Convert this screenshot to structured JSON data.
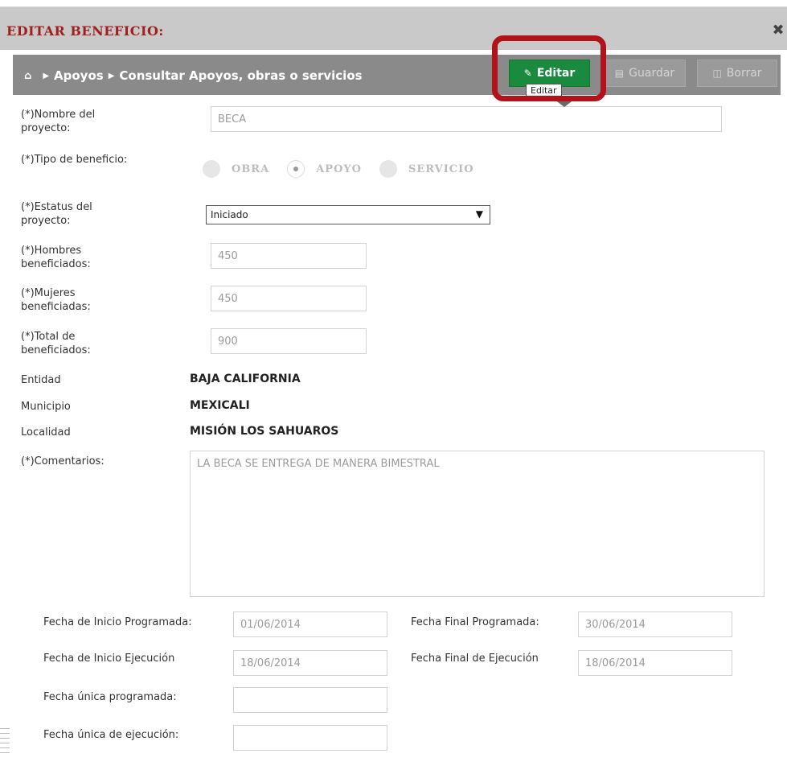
{
  "dialog": {
    "title": "Editar beneficio:",
    "close_symbol": "✖"
  },
  "breadcrumb": {
    "home_icon": "home-icon",
    "items": [
      "Apoyos",
      "Consultar Apoyos, obras o servicios"
    ]
  },
  "toolbar": {
    "edit_label": "Editar",
    "save_label": "Guardar",
    "delete_label": "Borrar",
    "tooltip": "Editar",
    "edit_color": "#1a8a3e",
    "highlight_color": "#b3121b"
  },
  "form": {
    "project_name_label_1": "(*)Nombre del",
    "project_name_label_2": "proyecto:",
    "project_name_value": "BECA",
    "benefit_type_label": "(*)Tipo de beneficio:",
    "benefit_options": [
      "OBRA",
      "APOYO",
      "SERVICIO"
    ],
    "benefit_selected": "APOYO",
    "status_label_1": "(*)Estatus del",
    "status_label_2": "proyecto:",
    "status_value": "Iniciado",
    "men_label_1": "(*)Hombres",
    "men_label_2": "beneficiados:",
    "men_value": "450",
    "women_label_1": "(*)Mujeres",
    "women_label_2": "beneficiadas:",
    "women_value": "450",
    "total_label_1": "(*)Total de",
    "total_label_2": "beneficiados:",
    "total_value": "900",
    "entity_label": "Entidad",
    "entity_value": "BAJA CALIFORNIA",
    "municipality_label": "Municipio",
    "municipality_value": "MEXICALI",
    "locality_label": "Localidad",
    "locality_value": "MISIÓN LOS SAHUAROS",
    "comments_label": "(*)Comentarios:",
    "comments_value": "LA BECA SE ENTREGA DE MANERA BIMESTRAL",
    "start_planned_label": "Fecha de Inicio Programada:",
    "start_planned_value": "01/06/2014",
    "end_planned_label": "Fecha Final Programada:",
    "end_planned_value": "30/06/2014",
    "start_exec_label": "Fecha de Inicio Ejecución",
    "start_exec_value": "18/06/2014",
    "end_exec_label": "Fecha Final de Ejecución",
    "end_exec_value": "18/06/2014",
    "single_planned_label": "Fecha única programada:",
    "single_planned_value": "",
    "single_exec_label": "Fecha única de ejecución:",
    "single_exec_value": ""
  }
}
